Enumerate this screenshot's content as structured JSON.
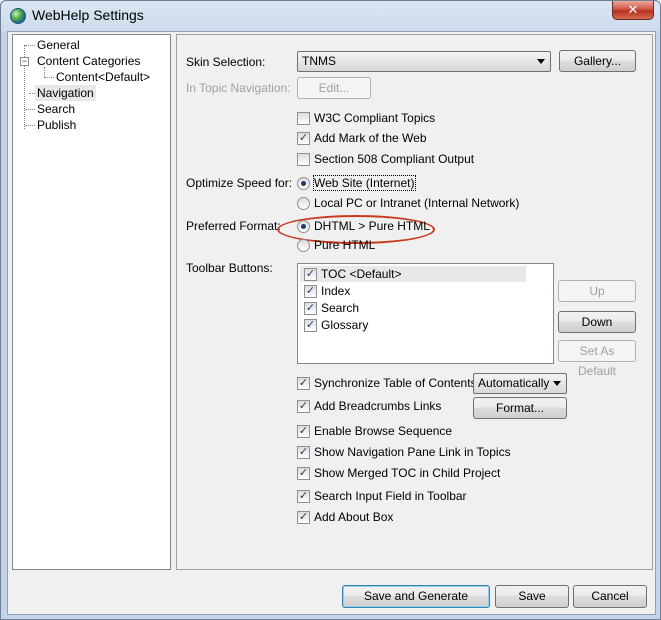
{
  "window": {
    "title": "WebHelp Settings",
    "close_glyph": "✕"
  },
  "tree": {
    "items": [
      {
        "label": "General"
      },
      {
        "label": "Content Categories",
        "expander": "−"
      },
      {
        "label": "Content<Default>"
      },
      {
        "label": "Navigation"
      },
      {
        "label": "Search"
      },
      {
        "label": "Publish"
      }
    ]
  },
  "skin": {
    "label": "Skin Selection:",
    "value": "TNMS",
    "gallery_button": "Gallery..."
  },
  "in_topic_nav": {
    "label": "In Topic Navigation:",
    "edit_button": "Edit..."
  },
  "checks_top": [
    {
      "label": "W3C Compliant Topics",
      "checked": false
    },
    {
      "label": "Add Mark of the Web",
      "checked": true
    },
    {
      "label": "Section 508 Compliant Output",
      "checked": false
    }
  ],
  "optimize": {
    "label": "Optimize Speed for:",
    "options": [
      {
        "label": "Web Site (Internet)",
        "selected": true
      },
      {
        "label": "Local PC or Intranet (Internal Network)",
        "selected": false
      }
    ]
  },
  "preferred": {
    "label": "Preferred Format:",
    "options": [
      {
        "label": "DHTML > Pure HTML",
        "selected": true
      },
      {
        "label": "Pure HTML",
        "selected": false
      }
    ]
  },
  "toolbar": {
    "label": "Toolbar Buttons:",
    "items": [
      {
        "label": "TOC <Default>",
        "checked": true
      },
      {
        "label": "Index",
        "checked": true
      },
      {
        "label": "Search",
        "checked": true
      },
      {
        "label": "Glossary",
        "checked": true
      }
    ],
    "up_button": "Up",
    "down_button": "Down",
    "set_default_button": "Set As Default"
  },
  "sync_toc": {
    "label": "Synchronize Table of Contents",
    "checked": true,
    "mode": "Automatically"
  },
  "breadcrumbs": {
    "label": "Add Breadcrumbs Links",
    "checked": true,
    "format_button": "Format..."
  },
  "checks_bottom": [
    {
      "label": "Enable Browse Sequence",
      "checked": true
    },
    {
      "label": "Show Navigation Pane Link in Topics",
      "checked": true
    },
    {
      "label": "Show Merged TOC in Child Project",
      "checked": true
    },
    {
      "label": "Search Input Field in Toolbar",
      "checked": true
    },
    {
      "label": "Add About Box",
      "checked": true
    }
  ],
  "footer": {
    "save_generate": "Save and Generate",
    "save": "Save",
    "cancel": "Cancel"
  },
  "check_glyph": "✓",
  "colors": {
    "annotation": "#c8391d",
    "title_bar": "#cddbec"
  }
}
